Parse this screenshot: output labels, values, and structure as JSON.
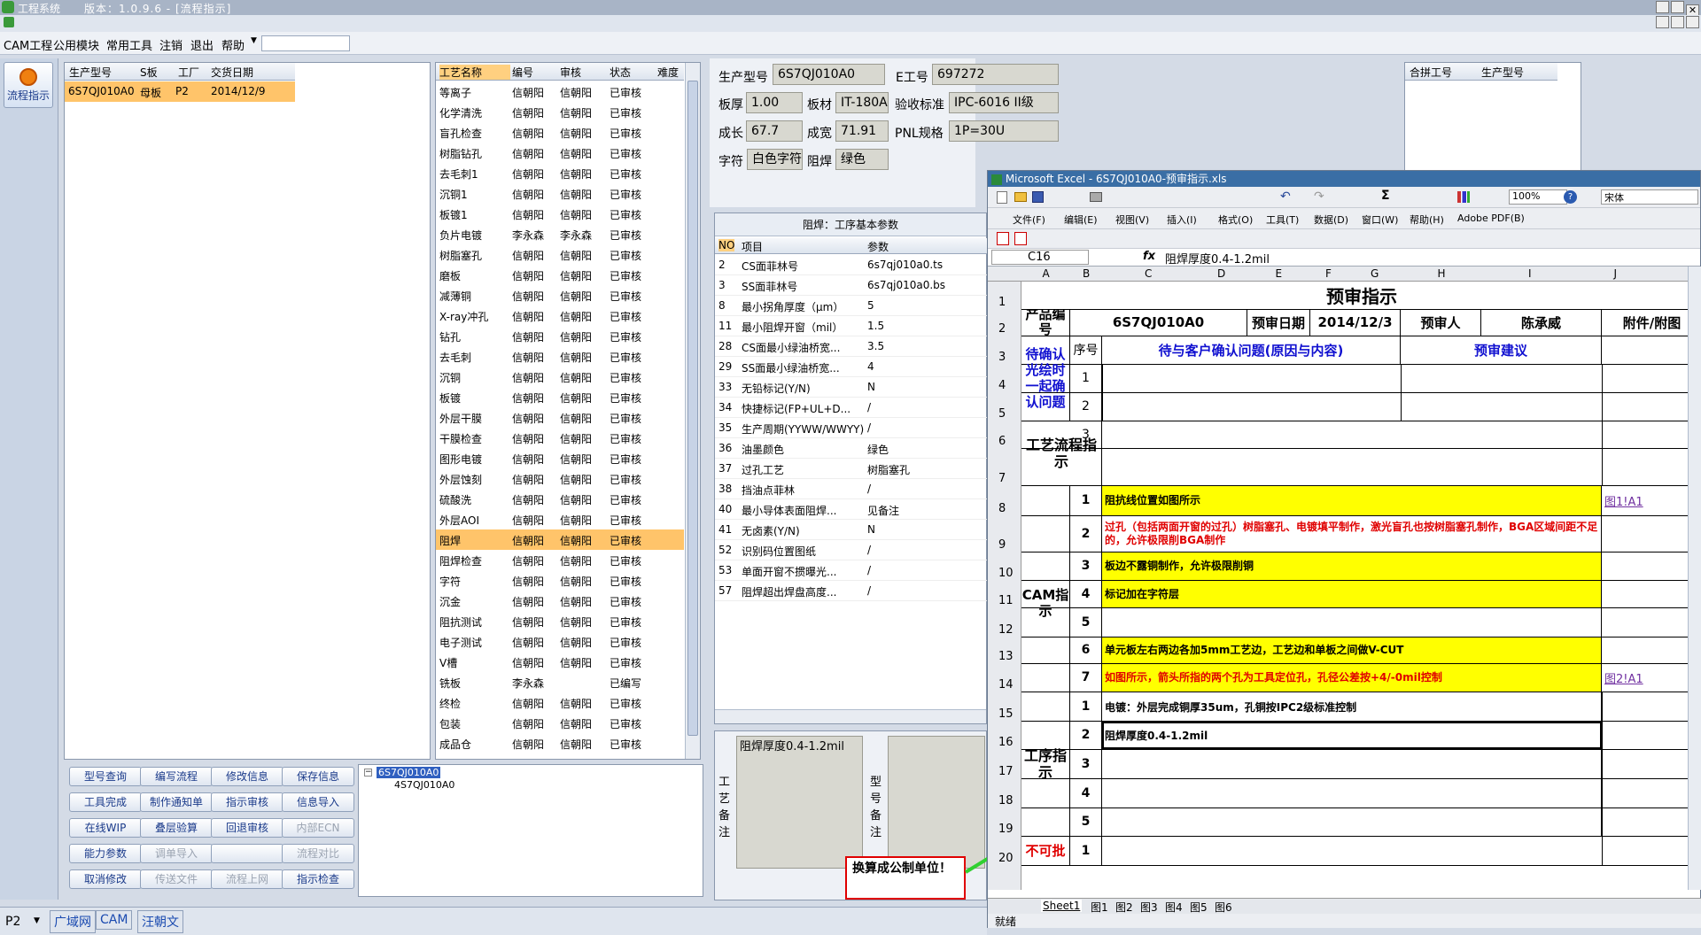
{
  "titlebar": {
    "app": "工程系统",
    "version": "版本：1.0.9.6 - [流程指示]"
  },
  "menu": [
    "CAM工程",
    "公用模块",
    "常用工具",
    "注销",
    "退出",
    "帮助"
  ],
  "side_button": "流程指示",
  "left_table": {
    "headers": [
      "生产型号",
      "S板",
      "工厂",
      "交货日期"
    ],
    "row": [
      "6S7QJ010A0",
      "母板",
      "P2",
      "2014/12/9"
    ]
  },
  "process_table": {
    "headers": [
      "工艺名称",
      "编号",
      "审核",
      "状态",
      "难度"
    ],
    "rows": [
      [
        "等离子",
        "信朝阳",
        "信朝阳",
        "已审核"
      ],
      [
        "化学清洗",
        "信朝阳",
        "信朝阳",
        "已审核"
      ],
      [
        "盲孔检查",
        "信朝阳",
        "信朝阳",
        "已审核"
      ],
      [
        "树脂钻孔",
        "信朝阳",
        "信朝阳",
        "已审核"
      ],
      [
        "去毛刺1",
        "信朝阳",
        "信朝阳",
        "已审核"
      ],
      [
        "沉铜1",
        "信朝阳",
        "信朝阳",
        "已审核"
      ],
      [
        "板镀1",
        "信朝阳",
        "信朝阳",
        "已审核"
      ],
      [
        "负片电镀",
        "李永森",
        "李永森",
        "已审核"
      ],
      [
        "树脂塞孔",
        "信朝阳",
        "信朝阳",
        "已审核"
      ],
      [
        "磨板",
        "信朝阳",
        "信朝阳",
        "已审核"
      ],
      [
        "减薄铜",
        "信朝阳",
        "信朝阳",
        "已审核"
      ],
      [
        "X-ray冲孔",
        "信朝阳",
        "信朝阳",
        "已审核"
      ],
      [
        "钻孔",
        "信朝阳",
        "信朝阳",
        "已审核"
      ],
      [
        "去毛刺",
        "信朝阳",
        "信朝阳",
        "已审核"
      ],
      [
        "沉铜",
        "信朝阳",
        "信朝阳",
        "已审核"
      ],
      [
        "板镀",
        "信朝阳",
        "信朝阳",
        "已审核"
      ],
      [
        "外层干膜",
        "信朝阳",
        "信朝阳",
        "已审核"
      ],
      [
        "干膜检查",
        "信朝阳",
        "信朝阳",
        "已审核"
      ],
      [
        "图形电镀",
        "信朝阳",
        "信朝阳",
        "已审核"
      ],
      [
        "外层蚀刻",
        "信朝阳",
        "信朝阳",
        "已审核"
      ],
      [
        "硫酸洗",
        "信朝阳",
        "信朝阳",
        "已审核"
      ],
      [
        "外层AOI",
        "信朝阳",
        "信朝阳",
        "已审核"
      ],
      [
        "阻焊",
        "信朝阳",
        "信朝阳",
        "已审核"
      ],
      [
        "阻焊检查",
        "信朝阳",
        "信朝阳",
        "已审核"
      ],
      [
        "字符",
        "信朝阳",
        "信朝阳",
        "已审核"
      ],
      [
        "沉金",
        "信朝阳",
        "信朝阳",
        "已审核"
      ],
      [
        "阻抗测试",
        "信朝阳",
        "信朝阳",
        "已审核"
      ],
      [
        "电子测试",
        "信朝阳",
        "信朝阳",
        "已审核"
      ],
      [
        "V槽",
        "信朝阳",
        "信朝阳",
        "已审核"
      ],
      [
        "铣板",
        "李永森",
        "",
        "已编写"
      ],
      [
        "终检",
        "信朝阳",
        "信朝阳",
        "已审核"
      ],
      [
        "包装",
        "信朝阳",
        "信朝阳",
        "已审核"
      ],
      [
        "成品仓",
        "信朝阳",
        "信朝阳",
        "已审核"
      ]
    ]
  },
  "buttons": [
    [
      "型号查询",
      "编写流程",
      "修改信息",
      "保存信息"
    ],
    [
      "工具完成",
      "制作通知单",
      "指示审核",
      "信息导入"
    ],
    [
      "在线WIP",
      "叠层验算",
      "回退审核",
      "内部ECN"
    ],
    [
      "能力参数",
      "调单导入",
      "",
      "流程对比"
    ],
    [
      "取消修改",
      "传送文件",
      "流程上网",
      "指示检查"
    ]
  ],
  "tree": {
    "root": "6S7QJ010A0",
    "child": "4S7QJ010A0"
  },
  "info": {
    "l_model": "生产型号",
    "model": "6S7QJ010A0",
    "l_eno": "E工号",
    "eno": "697272",
    "l_thick": "板厚",
    "thick": "1.00",
    "l_mat": "板材",
    "mat": "IT-180A",
    "l_std": "验收标准",
    "std": "IPC-6016 II级",
    "l_len": "成长",
    "len": "67.7",
    "l_wid": "成宽",
    "wid": "71.91",
    "l_pnl": "PNL规格",
    "pnl": "1P=30U",
    "l_char": "字符",
    "char": "白色字符",
    "l_mask": "阻焊",
    "mask": "绿色"
  },
  "merge_table": {
    "headers": [
      "合拼工号",
      "生产型号"
    ]
  },
  "param_panel": {
    "title": "阻焊：工序基本参数",
    "headers": [
      "NO",
      "项目",
      "参数"
    ],
    "rows": [
      [
        "2",
        "CS面菲林号",
        "6s7qj010a0.ts"
      ],
      [
        "3",
        "SS面菲林号",
        "6s7qj010a0.bs"
      ],
      [
        "8",
        "最小拐角厚度（μm）",
        "5"
      ],
      [
        "11",
        "最小阻焊开窗（mil）",
        "1.5"
      ],
      [
        "28",
        "CS面最小绿油桥宽...",
        "3.5"
      ],
      [
        "29",
        "SS面最小绿油桥宽...",
        "4"
      ],
      [
        "33",
        "无铅标记(Y/N)",
        "N"
      ],
      [
        "34",
        "快捷标记(FP+UL+D...",
        "/"
      ],
      [
        "35",
        "生产周期(YYWW/WWYY)",
        "/"
      ],
      [
        "36",
        "油墨颜色",
        "绿色"
      ],
      [
        "37",
        "过孔工艺",
        "树脂塞孔"
      ],
      [
        "38",
        "挡油点菲林",
        "/"
      ],
      [
        "40",
        "最小导体表面阻焊...",
        "见备注"
      ],
      [
        "41",
        "无卤素(Y/N)",
        "N"
      ],
      [
        "52",
        "识别码位置图纸",
        "/"
      ],
      [
        "53",
        "单面开窗不掼曝光...",
        "/"
      ],
      [
        "57",
        "阻焊超出焊盘高度...",
        "/"
      ]
    ]
  },
  "remark": {
    "label1": "工艺备注",
    "text": "阻焊厚度0.4-1.2mil",
    "label2": "型号备注"
  },
  "callout": "换算成公制单位！",
  "excel": {
    "title": "Microsoft Excel - 6S7QJ010A0-预审指示.xls",
    "menu": [
      "文件(F)",
      "编辑(E)",
      "视图(V)",
      "插入(I)",
      "格式(O)",
      "工具(T)",
      "数据(D)",
      "窗口(W)",
      "帮助(H)",
      "Adobe PDF(B)"
    ],
    "zoom": "100%",
    "font": "宋体",
    "cellref": "C16",
    "formula": "阻焊厚度0.4-1.2mil",
    "cols": [
      "A",
      "B",
      "C",
      "D",
      "E",
      "F",
      "G",
      "H",
      "I",
      "J"
    ],
    "rownums": [
      "1",
      "2",
      "3",
      "4",
      "5",
      "6",
      "7",
      "8",
      "9",
      "10",
      "11",
      "12",
      "13",
      "14",
      "15",
      "16",
      "17",
      "18",
      "19",
      "20"
    ],
    "sheet": {
      "title": "预审指示",
      "l_prod": "产品编号",
      "prod": "6S7QJ010A0",
      "l_date": "预审日期",
      "date": "2014/12/3",
      "l_rev": "预审人",
      "rev": "陈承威",
      "l_att": "附件/附图",
      "l_seq": "序号",
      "l_issue": "待与客户确认问题(原因与内容)",
      "l_sugg": "预审建议",
      "l_confirm": "待确认光绘时一起确认问题",
      "l_flow": "工艺流程指示",
      "l_cam": "CAM指示",
      "l_proc": "工序指示",
      "l_no": "不可批",
      "cam_rows": [
        {
          "n": "1",
          "t": "阻抗线位置如图所示",
          "a": "图1!A1"
        },
        {
          "n": "2",
          "t": "过孔（包括两面开窗的过孔）树脂塞孔、电镀填平制作，激光盲孔也按树脂塞孔制作，BGA区域间距不足的，允许极限削BGA制作",
          "a": ""
        },
        {
          "n": "3",
          "t": "板边不露铜制作，允许极限削铜",
          "a": ""
        },
        {
          "n": "4",
          "t": "标记加在字符层",
          "a": ""
        },
        {
          "n": "5",
          "t": "",
          "a": ""
        },
        {
          "n": "6",
          "t": "单元板左右两边各加5mm工艺边，工艺边和单板之间做V-CUT",
          "a": ""
        },
        {
          "n": "7",
          "t": "如图所示，箭头所指的两个孔为工具定位孔，孔径公差按+4/-0mil控制",
          "a": "图2!A1"
        }
      ],
      "proc_rows": [
        {
          "n": "1",
          "t": "电镀：外层完成铜厚35um，孔铜按IPC2级标准控制"
        },
        {
          "n": "2",
          "t": "阻焊厚度0.4-1.2mil"
        },
        {
          "n": "3",
          "t": ""
        },
        {
          "n": "4",
          "t": ""
        },
        {
          "n": "5",
          "t": ""
        }
      ],
      "last_n": "1"
    },
    "tabs": [
      "Sheet1",
      "图1",
      "图2",
      "图3",
      "图4",
      "图5",
      "图6"
    ],
    "status": "就绪"
  },
  "statusbar": {
    "plant": "P2",
    "items": [
      "广域网",
      "CAM",
      "汪朝文"
    ]
  },
  "colors": {
    "highlight": "#ffc46a",
    "yellow": "#ffff00",
    "red": "#e00000",
    "blue": "#1010d0",
    "accent": "#2a5ab0"
  }
}
